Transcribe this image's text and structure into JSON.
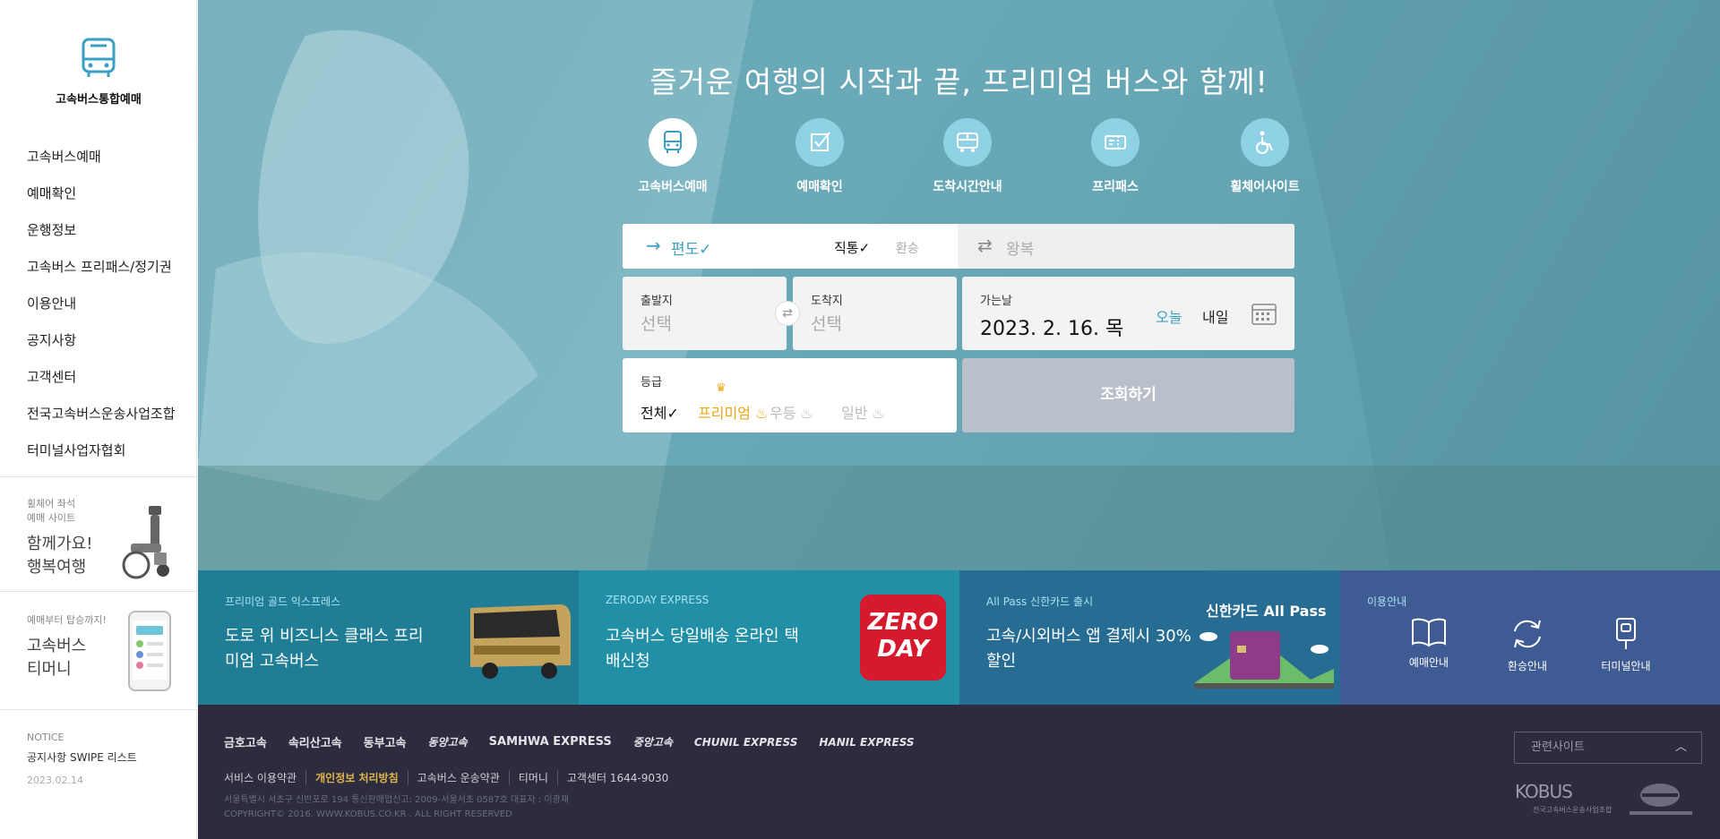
{
  "sidebar": {
    "logo_text": "고속버스통합예매",
    "nav": [
      "고속버스예매",
      "예매확인",
      "운행정보",
      "고속버스 프리패스/정기권",
      "이용안내",
      "공지사항",
      "고객센터",
      "전국고속버스운송사업조합",
      "터미널사업자협회"
    ],
    "wheelchair": {
      "small1": "휠체어 좌석",
      "small2": "예매 사이트",
      "big1": "함께가요!",
      "big2": "행복여행"
    },
    "tmoney": {
      "small": "예매부터 탑승까지!",
      "big1": "고속버스",
      "big2": "티머니"
    },
    "notice": {
      "label": "NOTICE",
      "title": "공지사항 SWIPE 리스트",
      "date": "2023.02.14"
    }
  },
  "hero": {
    "title": "즐거운 여행의 시작과 끝, 프리미엄 버스와 함께!",
    "quick_links": [
      {
        "label": "고속버스예매",
        "icon": "bus-icon"
      },
      {
        "label": "예매확인",
        "icon": "check-icon"
      },
      {
        "label": "도착시간안내",
        "icon": "bus-arrival-icon"
      },
      {
        "label": "프리패스",
        "icon": "ticket-icon"
      },
      {
        "label": "휠체어사이트",
        "icon": "wheelchair-icon"
      }
    ]
  },
  "booking": {
    "oneway_arrow": "→",
    "oneway_label": "편도✓",
    "direct_label": "직통✓",
    "transfer_label": "환승",
    "round_arrow": "⇄",
    "round_label": "왕복",
    "departure_label": "출발지",
    "departure_value": "선택",
    "arrival_label": "도착지",
    "arrival_value": "선택",
    "swap_symbol": "⇄",
    "date_label": "가는날",
    "date_value": "2023. 2. 16. 목",
    "today_label": "오늘",
    "tomorrow_label": "내일",
    "grade_label": "등급",
    "grade_all": "전체✓",
    "grade_premium": "프리미엄",
    "grade_first": "우등",
    "grade_normal": "일반",
    "crown": "♛",
    "search_label": "조회하기"
  },
  "promos": [
    {
      "small": "프리미엄 골드 익스프레스",
      "big": "도로 위 비즈니스 클래스 프리미엄 고속버스"
    },
    {
      "small": "ZERODAY EXPRESS",
      "big": "고속버스 당일배송 온라인 택배신청",
      "badge": "ZERO DAY"
    },
    {
      "small": "All Pass 신한카드 출시",
      "big": "고속/시외버스 앱 결제시 30% 할인",
      "card_title": "신한카드 All Pass"
    },
    {
      "small": "이용안내",
      "items": [
        "예매안내",
        "환승안내",
        "터미널안내"
      ]
    }
  ],
  "footer": {
    "brands": [
      "금호고속",
      "속리산고속",
      "동부고속",
      "동양고속",
      "SAMHWA EXPRESS",
      "중앙고속",
      "CHUNIL EXPRESS",
      "HANIL EXPRESS"
    ],
    "links": [
      "서비스 이용약관",
      "개인정보 처리방침",
      "고속버스 운송약관",
      "티머니",
      "고객센터 1644-9030"
    ],
    "address": "서울특별시 서초구 신반포로 194 통신판매업신고: 2009-서울서초 0587호 대표자 : 이광재",
    "copyright": "COPYRIGHT© 2016. WWW.KOBUS.CO.KR . ALL RIGHT RESERVED",
    "related_label": "관련사이트",
    "kobus_logo": "KOBUS",
    "kobus_sub": "전국고속버스운송사업조합"
  },
  "colors": {
    "accent": "#3a9fc2",
    "premium": "#f0a613",
    "footer_bg": "#2c2c3e"
  }
}
